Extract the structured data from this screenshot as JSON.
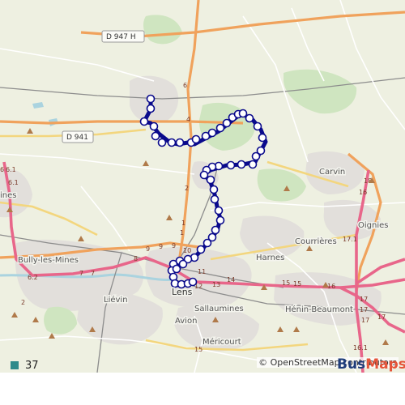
{
  "map": {
    "places": [
      {
        "name": "Carvin",
        "size": "md"
      },
      {
        "name": "Oignies",
        "size": "md"
      },
      {
        "name": "Courrières",
        "size": "md"
      },
      {
        "name": "Harnes",
        "size": "md"
      },
      {
        "name": "Bully-les-Mines",
        "size": "md"
      },
      {
        "name": "Liévin",
        "size": "md"
      },
      {
        "name": "Lens",
        "size": "lg"
      },
      {
        "name": "Sallaumines",
        "size": "md"
      },
      {
        "name": "Hénin-Beaumont",
        "size": "md"
      },
      {
        "name": "Avion",
        "size": "md"
      },
      {
        "name": "Méricourt",
        "size": "md"
      },
      {
        "name": "ines",
        "size": "md"
      }
    ],
    "road_shields": [
      "D 947 H",
      "D 941"
    ],
    "road_numbers": [
      "6",
      "4",
      "2",
      "1",
      "1",
      "9",
      "9",
      "9",
      "10",
      "11",
      "12",
      "13",
      "14",
      "15",
      "15",
      "16",
      "17",
      "17",
      "17",
      "17",
      "18",
      "16",
      "16.1",
      "17.1",
      "15",
      "2",
      "6.2",
      "7",
      "7",
      "6",
      "8",
      "6.1",
      "6.1"
    ],
    "attribution_prefix": "© ",
    "attribution_link": "OpenStreetMap contributors"
  },
  "route": {
    "line_name": "37",
    "color": "#2e8b8b",
    "path_color": "#0a0a8c"
  },
  "brand": {
    "part1": "Bus",
    "part2": "Maps"
  }
}
